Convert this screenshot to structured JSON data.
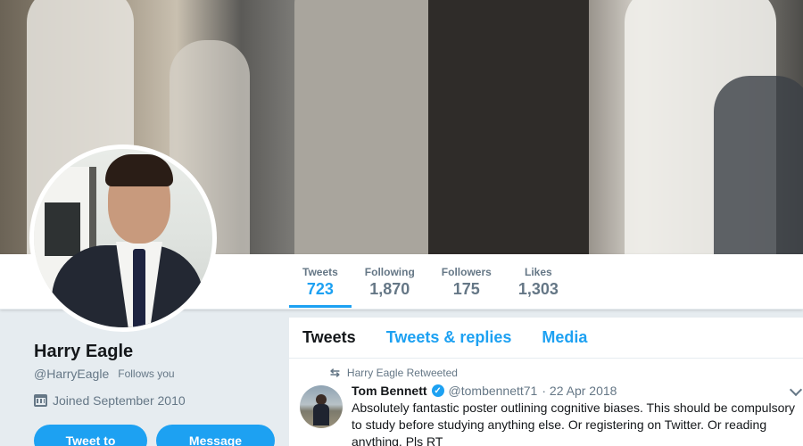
{
  "profile": {
    "name": "Harry Eagle",
    "handle": "@HarryEagle",
    "follows_you": "Follows you",
    "joined": "Joined September 2010",
    "tweet_to_label": "Tweet to",
    "message_label": "Message"
  },
  "stats": [
    {
      "label": "Tweets",
      "value": "723"
    },
    {
      "label": "Following",
      "value": "1,870"
    },
    {
      "label": "Followers",
      "value": "175"
    },
    {
      "label": "Likes",
      "value": "1,303"
    }
  ],
  "timeline": {
    "tabs": [
      "Tweets",
      "Tweets & replies",
      "Media"
    ],
    "tweet": {
      "retweeted_by": "Harry Eagle Retweeted",
      "author_name": "Tom Bennett",
      "author_handle": "@tombennett71",
      "date": "· 22 Apr 2018",
      "text": "Absolutely fantastic poster outlining cognitive biases. This should be compulsory to study before studying anything else. Or registering on Twitter. Or reading anything. Pls RT"
    }
  },
  "colors": {
    "accent": "#1da1f2",
    "muted": "#657786",
    "background": "#e6ecf0"
  },
  "icons": [
    "calendar-icon",
    "retweet-icon",
    "verified-icon",
    "chevron-down-icon"
  ]
}
